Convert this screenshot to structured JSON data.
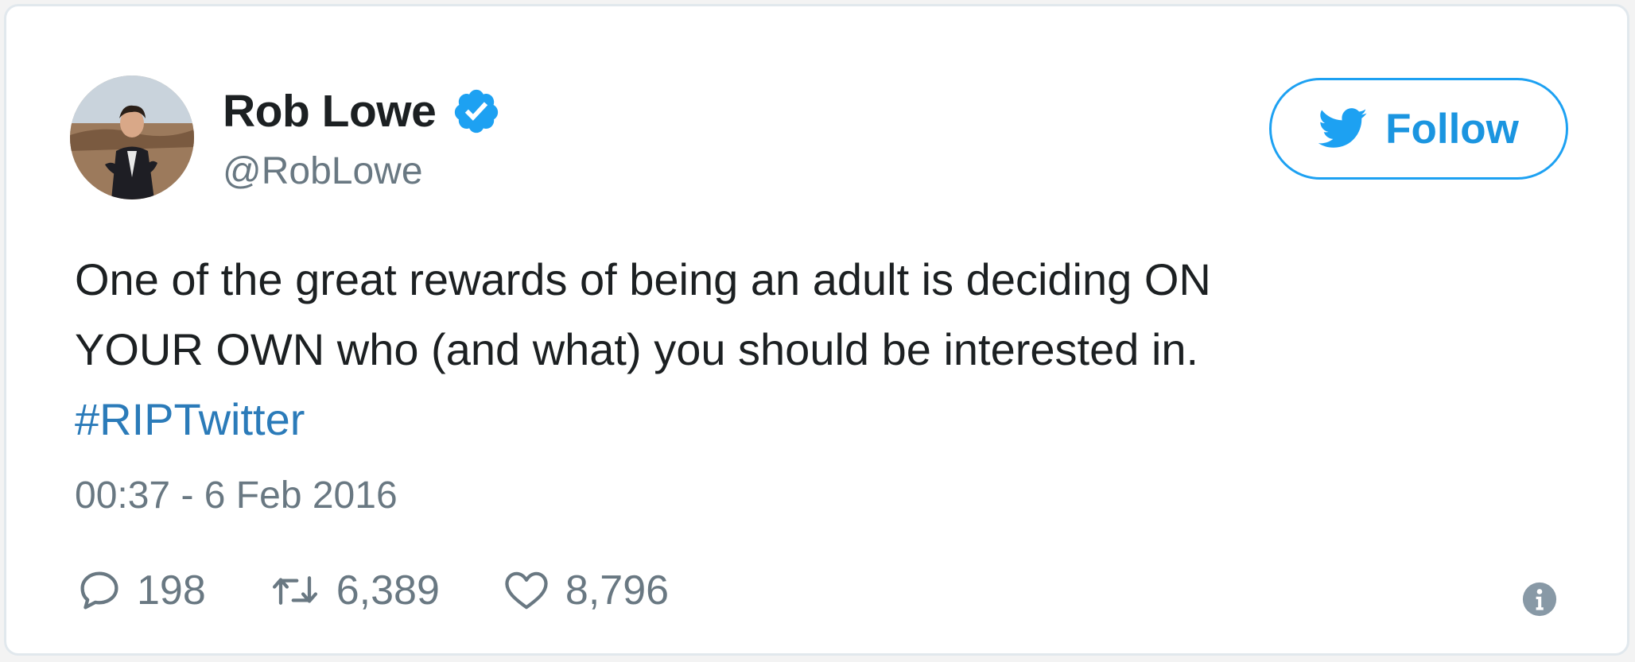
{
  "user": {
    "display_name": "Rob Lowe",
    "handle": "@RobLowe",
    "verified_icon": "verified-badge-icon",
    "avatar_icon": "profile-photo"
  },
  "follow_button": {
    "label": "Follow",
    "icon": "twitter-bird-icon"
  },
  "tweet": {
    "line1": "One of the great rewards of being an adult is deciding ON",
    "line2": "YOUR OWN who (and what) you should be interested in.",
    "hashtag": "#RIPTwitter",
    "timestamp": "00:37 - 6 Feb 2016"
  },
  "actions": {
    "replies": {
      "icon": "reply-icon",
      "count": "198"
    },
    "retweets": {
      "icon": "retweet-icon",
      "count": "6,389"
    },
    "likes": {
      "icon": "heart-icon",
      "count": "8,796"
    },
    "info": {
      "icon": "info-icon"
    }
  },
  "colors": {
    "accent": "#1da1f2",
    "link": "#2b7bb9",
    "text": "#1c2022",
    "muted": "#697882",
    "border": "#e1e8ed"
  }
}
